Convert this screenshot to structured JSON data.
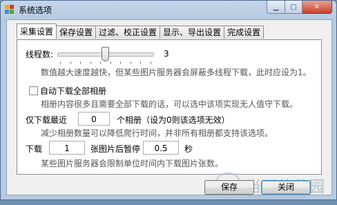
{
  "window": {
    "title": "系统选项",
    "close_glyph": "✕",
    "min_glyph": "▁",
    "max_glyph": "□"
  },
  "tabs": [
    {
      "label": "采集设置",
      "active": true
    },
    {
      "label": "保存设置"
    },
    {
      "label": "过滤、校正设置"
    },
    {
      "label": "显示、导出设置"
    },
    {
      "label": "完成设置"
    }
  ],
  "collect": {
    "threads_label": "线程数:",
    "threads_value": "3",
    "threads_slider_fraction": 0.5,
    "threads_hint": "数值越大速度越快，但某些图片服务器会屏蔽多线程下载，此时应设为1。",
    "auto_download_label": "自动下载全部相册",
    "auto_download_checked": false,
    "auto_download_hint": "相册内容很多且需要全部下载的话，可以选中该项实现无人值守下载。",
    "recent_prefix": "仅下载最近",
    "recent_value": "0",
    "recent_suffix": "个相册（设为0则该选项无效）",
    "recent_hint": "减少相册数量可以降低爬行时间，并非所有相册都支持该选项。",
    "download_prefix": "下载",
    "download_count": "1",
    "download_mid": "张图片后暂停",
    "pause_seconds": "0.5",
    "pause_unit": "秒",
    "download_hint": "某些图片服务器会限制单位时间内下载图片张数。"
  },
  "buttons": {
    "save": "保存",
    "close": "关闭"
  },
  "watermark": {
    "text": "当下软件园",
    "url": "WWW.DOWNXIA.COM"
  }
}
